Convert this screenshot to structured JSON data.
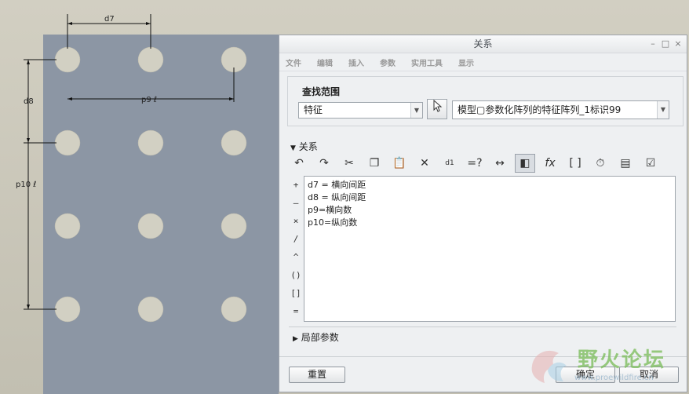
{
  "cad": {
    "dims": {
      "d7": "d7",
      "d8": "d8",
      "p9": "p9 ℓ",
      "p10": "p10 ℓ"
    }
  },
  "dialog": {
    "title": "关系",
    "window_controls": [
      "–",
      "□",
      "×"
    ],
    "menu": [
      "文件",
      "编辑",
      "插入",
      "参数",
      "实用工具",
      "显示"
    ],
    "scope": {
      "label": "查找范围",
      "type_value": "特征",
      "target_value": "模型▢参数化阵列的特征阵列_1标识99"
    },
    "relations": {
      "header": "关系",
      "operators": [
        "+",
        "–",
        "×",
        "/",
        "^",
        "()",
        "[]",
        "="
      ],
      "lines": [
        "d7 = 横向间距",
        "d8 = 纵向间距",
        "p9=横向数",
        "p10=纵向数"
      ]
    },
    "local_params": "局部参数",
    "buttons": {
      "reset": "重置",
      "ok": "确定",
      "cancel": "取消"
    },
    "watermark": {
      "title": "野火论坛",
      "url": "www.proewildfire.cn"
    }
  }
}
